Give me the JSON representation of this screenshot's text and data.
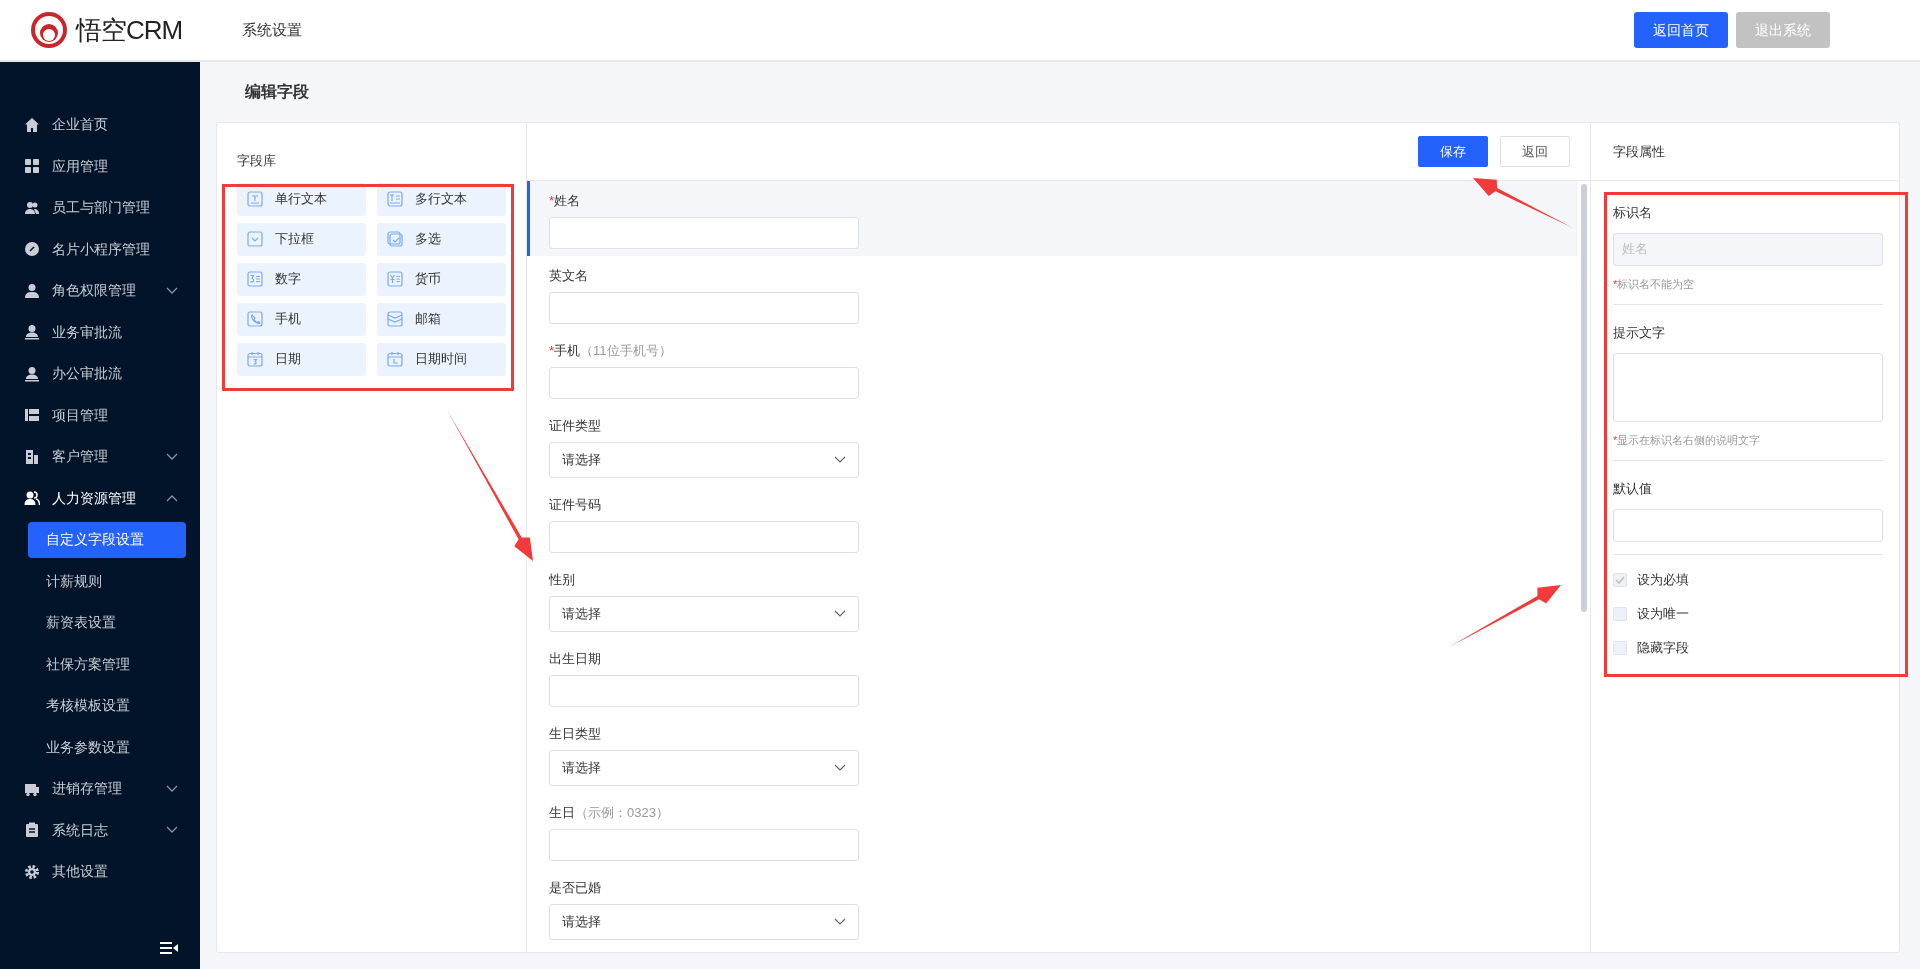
{
  "header": {
    "logo_text": "悟空CRM",
    "title": "系统设置",
    "buttons": [
      {
        "label": "返回首页",
        "kind": "primary"
      },
      {
        "label": "退出系统",
        "kind": "disabled"
      }
    ]
  },
  "sidebar": {
    "items": [
      {
        "label": "企业首页",
        "selected": false
      },
      {
        "label": "应用管理",
        "selected": false
      },
      {
        "label": "员工与部门管理",
        "selected": false
      },
      {
        "label": "名片小程序管理",
        "selected": false
      },
      {
        "label": "角色权限管理",
        "selected": false,
        "expanded": false
      },
      {
        "label": "业务审批流",
        "selected": false
      },
      {
        "label": "办公审批流",
        "selected": false
      },
      {
        "label": "项目管理",
        "selected": false
      },
      {
        "label": "客户管理",
        "selected": false,
        "expanded": false
      },
      {
        "label": "人力资源管理",
        "selected": false,
        "expanded": true,
        "children": [
          {
            "label": "自定义字段设置",
            "selected": true
          },
          {
            "label": "计薪规则",
            "selected": false
          },
          {
            "label": "薪资表设置",
            "selected": false
          },
          {
            "label": "社保方案管理",
            "selected": false
          },
          {
            "label": "考核模板设置",
            "selected": false
          },
          {
            "label": "业务参数设置",
            "selected": false
          }
        ]
      },
      {
        "label": "进销存管理",
        "selected": false,
        "expanded": false
      },
      {
        "label": "系统日志",
        "selected": false,
        "expanded": false
      },
      {
        "label": "其他设置",
        "selected": false
      }
    ]
  },
  "page_title": "编辑字段",
  "field_library": {
    "title": "字段库",
    "items": [
      {
        "label": "单行文本"
      },
      {
        "label": "多行文本"
      },
      {
        "label": "下拉框"
      },
      {
        "label": "多选"
      },
      {
        "label": "数字"
      },
      {
        "label": "货币"
      },
      {
        "label": "手机"
      },
      {
        "label": "邮箱"
      },
      {
        "label": "日期"
      },
      {
        "label": "日期时间"
      }
    ]
  },
  "form": {
    "buttons": [
      {
        "label": "保存",
        "kind": "primary"
      },
      {
        "label": "返回",
        "kind": "outline"
      }
    ],
    "fields": [
      {
        "mark": "*",
        "label": "姓名",
        "kind": "text",
        "selected": true
      },
      {
        "label": "英文名",
        "kind": "text",
        "selected": false
      },
      {
        "mark": "*",
        "label": "手机",
        "hint": "（11位手机号）",
        "kind": "text",
        "selected": false
      },
      {
        "label": "证件类型",
        "kind": "select",
        "placeholder": "请选择",
        "selected": false
      },
      {
        "label": "证件号码",
        "kind": "text",
        "selected": false
      },
      {
        "label": "性别",
        "kind": "select",
        "placeholder": "请选择",
        "selected": false
      },
      {
        "label": "出生日期",
        "kind": "text",
        "selected": false
      },
      {
        "label": "生日类型",
        "kind": "select",
        "placeholder": "请选择",
        "selected": false
      },
      {
        "label": "生日",
        "hint": "（示例：0323）",
        "kind": "text",
        "selected": false
      },
      {
        "label": "是否已婚",
        "kind": "select",
        "placeholder": "请选择",
        "selected": false
      }
    ]
  },
  "properties": {
    "title": "字段属性",
    "name_field": {
      "label": "标识名",
      "value": "姓名",
      "disabled": true,
      "note_mark": "*",
      "note": "标识名不能为空"
    },
    "hint_field": {
      "label": "提示文字",
      "note_mark": "*",
      "note": "显示在标识名右侧的说明文字"
    },
    "default_field": {
      "label": "默认值"
    },
    "options": [
      {
        "label": "设为必填",
        "checked": true,
        "disabled": true
      },
      {
        "label": "设为唯一",
        "checked": false,
        "disabled": false
      },
      {
        "label": "隐藏字段",
        "checked": false,
        "disabled": false
      }
    ]
  },
  "annotations": [
    {
      "kind": "box"
    },
    {
      "kind": "box"
    },
    {
      "kind": "arrow"
    },
    {
      "kind": "arrow"
    },
    {
      "kind": "arrow"
    }
  ]
}
